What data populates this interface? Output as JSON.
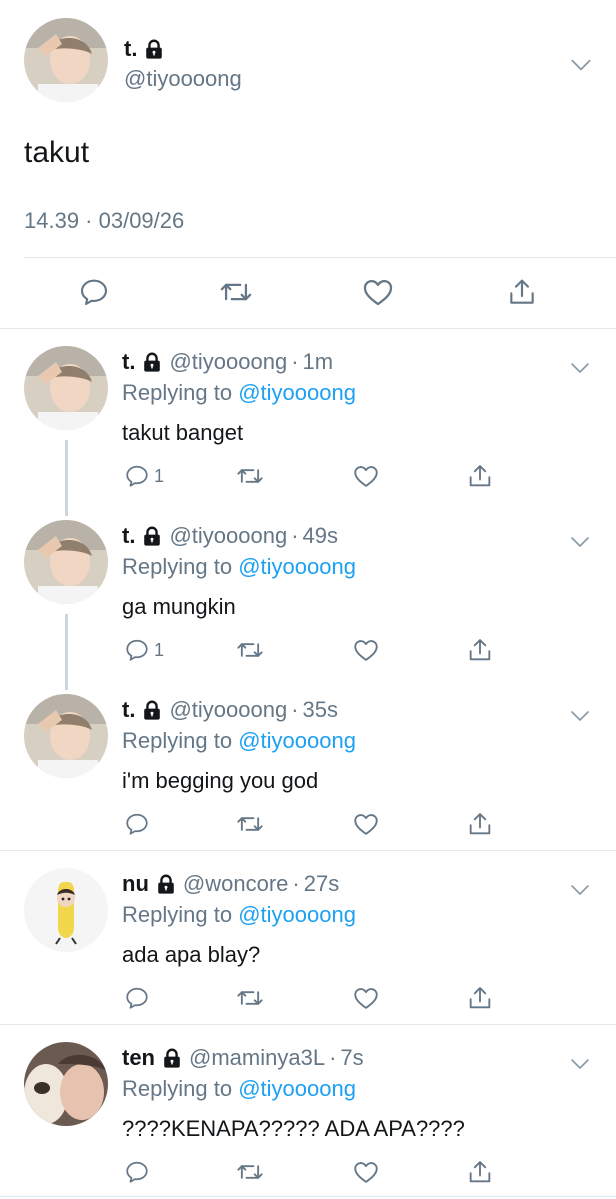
{
  "main_tweet": {
    "name": "t.",
    "handle": "@tiyoooong",
    "text": "takut",
    "timestamp": "14.39 · 03/09/26",
    "icons": {
      "reply": "reply-icon",
      "retweet": "retweet-icon",
      "like": "heart-icon",
      "share": "share-icon",
      "lock": "lock-icon",
      "more": "chevron-down-icon"
    }
  },
  "colors": {
    "link": "#1da1f2",
    "secondary_text": "#657786",
    "divider": "#e1e8ed",
    "thread_line": "#ccd6dd"
  },
  "replies": [
    {
      "name": "t.",
      "handle": "@tiyoooong",
      "time": "1m",
      "replying_prefix": "Replying to",
      "replying_to": "@tiyoooong",
      "text": "takut banget",
      "reply_count": "1"
    },
    {
      "name": "t.",
      "handle": "@tiyoooong",
      "time": "49s",
      "replying_prefix": "Replying to",
      "replying_to": "@tiyoooong",
      "text": "ga mungkin",
      "reply_count": "1"
    },
    {
      "name": "t.",
      "handle": "@tiyoooong",
      "time": "35s",
      "replying_prefix": "Replying to",
      "replying_to": "@tiyoooong",
      "text": "i'm begging you god",
      "reply_count": ""
    },
    {
      "name": "nu",
      "handle": "@woncore",
      "time": "27s",
      "replying_prefix": "Replying to",
      "replying_to": "@tiyoooong",
      "text": "ada apa blay?",
      "reply_count": ""
    },
    {
      "name": "ten",
      "handle": "@maminya3L",
      "time": "7s",
      "replying_prefix": "Replying to",
      "replying_to": "@tiyoooong",
      "text": "????KENAPA????? ADA APA????",
      "reply_count": ""
    }
  ]
}
